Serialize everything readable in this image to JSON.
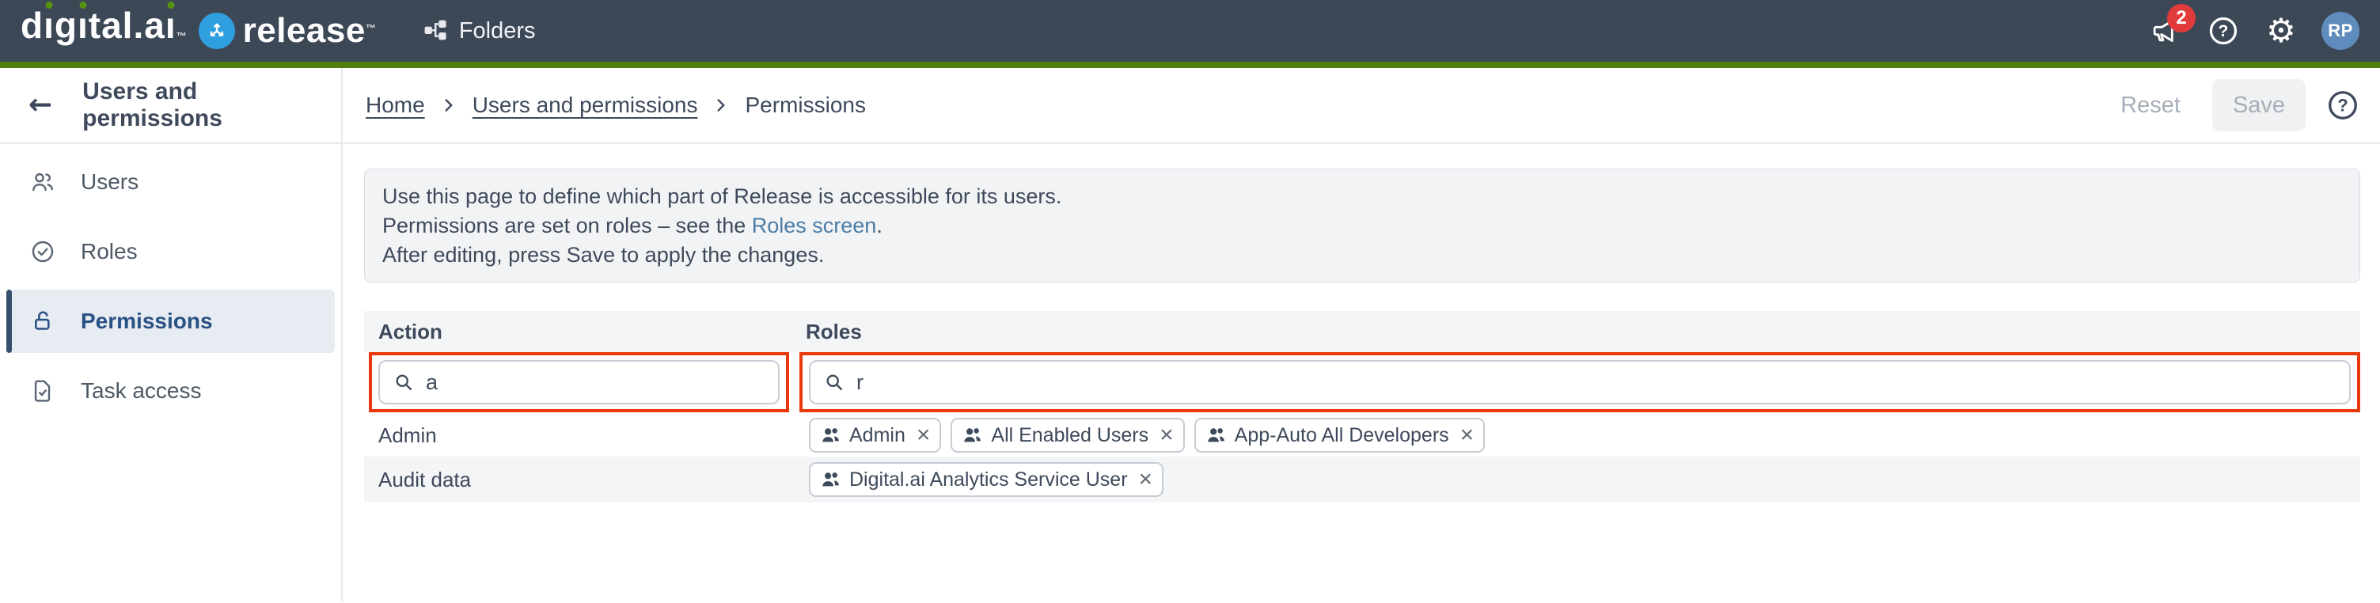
{
  "topbar": {
    "brand": "digital.ai",
    "brand_segments": [
      "d",
      "ı",
      "g",
      "ı",
      "tal.a",
      "ı"
    ],
    "brand_tm": "™",
    "product": "release",
    "product_tm": "™",
    "nav_folders": "Folders",
    "notification_count": "2",
    "avatar_initials": "RP"
  },
  "header": {
    "title": "Users and permissions",
    "breadcrumbs": [
      "Home",
      "Users and permissions",
      "Permissions"
    ],
    "reset_label": "Reset",
    "save_label": "Save"
  },
  "sidebar": {
    "items": [
      {
        "label": "Users",
        "icon": "users-icon",
        "selected": false
      },
      {
        "label": "Roles",
        "icon": "check-circle-icon",
        "selected": false
      },
      {
        "label": "Permissions",
        "icon": "open-lock-icon",
        "selected": true
      },
      {
        "label": "Task access",
        "icon": "task-document-icon",
        "selected": false
      }
    ]
  },
  "info": {
    "line1": "Use this page to define which part of Release is accessible for its users.",
    "line2_prefix": "Permissions are set on roles – see the ",
    "line2_link": "Roles screen",
    "line2_suffix": ".",
    "line3": "After editing, press Save to apply the changes."
  },
  "table": {
    "columns": [
      "Action",
      "Roles"
    ],
    "filters": {
      "action_value": "a",
      "roles_value": "r"
    },
    "rows": [
      {
        "action": "Admin",
        "roles": [
          "Admin",
          "All Enabled Users",
          "App-Auto All Developers"
        ]
      },
      {
        "action": "Audit data",
        "roles": [
          "Digital.ai Analytics Service User"
        ]
      }
    ]
  },
  "colors": {
    "topbar_bg": "#3d4857",
    "accent_green": "#4f7d10",
    "logo_green": "#55930f",
    "filter_highlight_red": "#e8380c",
    "link_blue": "#4b7ca6",
    "selected_nav_bg": "#e7ebf2",
    "selected_nav_accent": "#374e6d",
    "selected_nav_text": "#2a5183",
    "avatar_bg": "#5f8cbd",
    "badge_red": "#e23b3b",
    "release_logo_blue": "#2f9fe0",
    "text_primary": "#3f4b5d"
  }
}
